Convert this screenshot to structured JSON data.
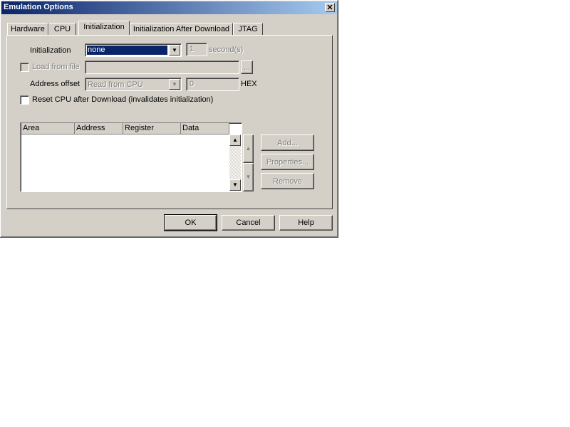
{
  "window": {
    "title": "Emulation Options",
    "close_glyph": "✕"
  },
  "tabs": [
    {
      "label": "Hardware",
      "active": false
    },
    {
      "label": "CPU",
      "active": false
    },
    {
      "label": "Initialization",
      "active": true
    },
    {
      "label": "Initialization After Download",
      "active": false
    },
    {
      "label": "JTAG",
      "active": false
    }
  ],
  "form": {
    "initialization_label": "Initialization",
    "initialization_value": "none",
    "seconds_value": "1",
    "seconds_unit": "second(s)",
    "load_from_file_label": "Load from file",
    "load_from_file_value": "",
    "browse_label": "...",
    "address_offset_label": "Address offset",
    "address_offset_source": "Read from CPU",
    "address_offset_value": "0",
    "address_offset_unit": "HEX",
    "reset_cpu_label": "Reset CPU after Download (invalidates initialization)"
  },
  "table": {
    "columns": [
      "Area",
      "Address",
      "Register",
      "Data"
    ],
    "rows": []
  },
  "side_buttons": {
    "add": "Add...",
    "properties": "Properties...",
    "remove": "Remove"
  },
  "footer": {
    "ok": "OK",
    "cancel": "Cancel",
    "help": "Help"
  },
  "icons": {
    "dropdown": "triangle-down",
    "scroll_up": "triangle-up",
    "scroll_down": "triangle-down",
    "move_up": "triangle-up",
    "move_down": "triangle-down"
  }
}
